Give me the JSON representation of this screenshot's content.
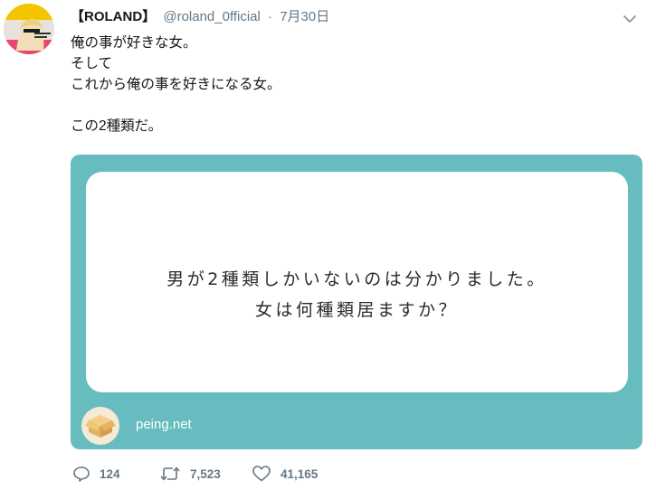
{
  "user": {
    "display_name": "【ROLAND】",
    "handle": "@roland_0fficial",
    "separator": "·",
    "date": "7月30日"
  },
  "tweet": {
    "lines": [
      "俺の事が好きな女。",
      "そして",
      "これから俺の事を好きになる女。",
      "",
      "この2種類だ。"
    ]
  },
  "card": {
    "question_lines": [
      "男が2種類しかいないのは分かりました。",
      "女は何種類居ますか？"
    ],
    "site": "peing.net",
    "background": "#66bcbe"
  },
  "actions": {
    "replies": "124",
    "retweets": "7,523",
    "likes": "41,165"
  },
  "icons": {
    "caret": "chevron-down-icon",
    "reply": "reply-icon",
    "retweet": "retweet-icon",
    "like": "heart-icon"
  }
}
